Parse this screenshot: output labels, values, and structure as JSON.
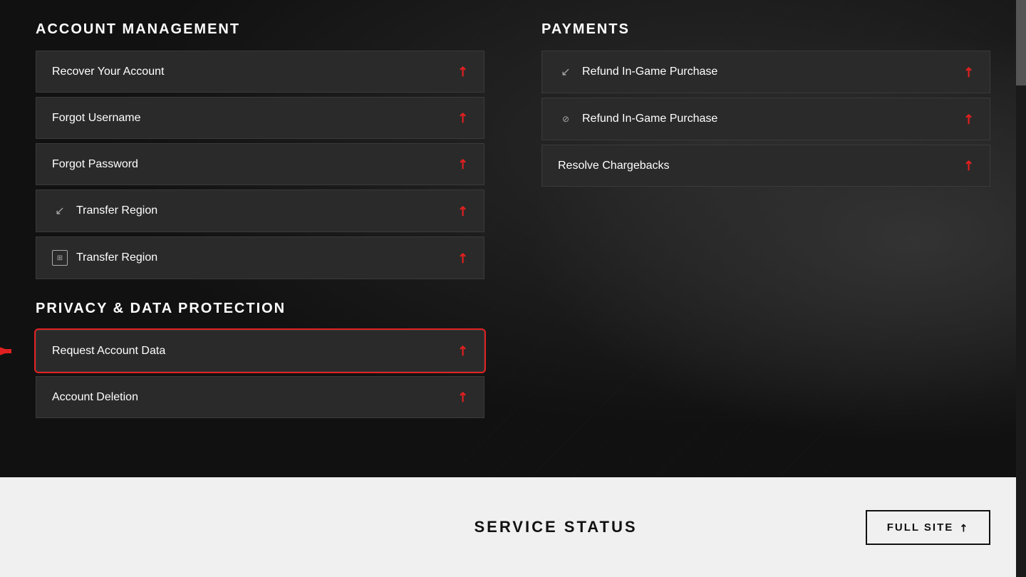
{
  "account_management": {
    "section_title": "ACCOUNT MANAGEMENT",
    "items": [
      {
        "id": "recover-account",
        "label": "Recover Your Account",
        "has_icon": false,
        "icon": ""
      },
      {
        "id": "forgot-username",
        "label": "Forgot Username",
        "has_icon": false,
        "icon": ""
      },
      {
        "id": "forgot-password",
        "label": "Forgot Password",
        "has_icon": false,
        "icon": ""
      },
      {
        "id": "transfer-region-1",
        "label": "Transfer Region",
        "has_icon": true,
        "icon": "↙"
      },
      {
        "id": "transfer-region-2",
        "label": "Transfer Region",
        "has_icon": true,
        "icon": "⊘"
      }
    ]
  },
  "privacy": {
    "section_title": "PRIVACY & DATA PROTECTION",
    "items": [
      {
        "id": "request-account-data",
        "label": "Request Account Data",
        "highlighted": true
      },
      {
        "id": "account-deletion",
        "label": "Account Deletion",
        "highlighted": false
      }
    ]
  },
  "payments": {
    "section_title": "PAYMENTS",
    "items": [
      {
        "id": "refund-ingame-1",
        "label": "Refund In-Game Purchase",
        "has_icon": true,
        "icon": "↙"
      },
      {
        "id": "refund-ingame-2",
        "label": "Refund In-Game Purchase",
        "has_icon": true,
        "icon": "⊘"
      },
      {
        "id": "resolve-chargebacks",
        "label": "Resolve Chargebacks",
        "has_icon": false,
        "icon": ""
      }
    ]
  },
  "footer": {
    "service_status_label": "SERVICE STATUS",
    "full_site_label": "FULL SITE",
    "arrow": "↗"
  },
  "icons": {
    "arrow_external": "↗"
  }
}
